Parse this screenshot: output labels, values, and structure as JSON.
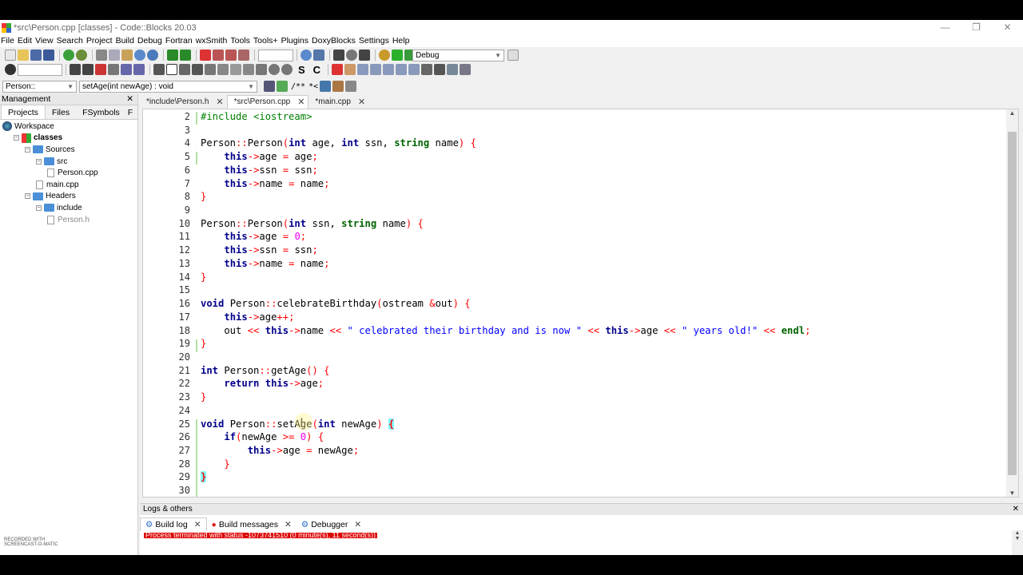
{
  "window": {
    "title": "*src\\Person.cpp [classes] - Code::Blocks 20.03",
    "controls": [
      "—",
      "❐",
      "✕"
    ]
  },
  "menu": [
    "File",
    "Edit",
    "View",
    "Search",
    "Project",
    "Build",
    "Debug",
    "Fortran",
    "wxSmith",
    "Tools",
    "Tools+",
    "Plugins",
    "DoxyBlocks",
    "Settings",
    "Help"
  ],
  "toolbar": {
    "build_target": "Debug",
    "scope_combo": "Person::",
    "function_combo": "setAge(int newAge) : void",
    "letter_s": "S",
    "letter_c": "C",
    "comment_btn": "/**",
    "doc_btn": "*<"
  },
  "management": {
    "title": "Management",
    "close": "✕",
    "tabs": [
      "Projects",
      "Files",
      "FSymbols",
      "F"
    ],
    "tree": [
      {
        "label": "Workspace",
        "level": 0,
        "kind": "workspace"
      },
      {
        "label": "classes",
        "level": 1,
        "kind": "project",
        "toggle": "−"
      },
      {
        "label": "Sources",
        "level": 2,
        "kind": "folder",
        "toggle": "−"
      },
      {
        "label": "src",
        "level": 3,
        "kind": "folder",
        "toggle": "−"
      },
      {
        "label": "Person.cpp",
        "level": 4,
        "kind": "file"
      },
      {
        "label": "main.cpp",
        "level": 3,
        "kind": "file"
      },
      {
        "label": "Headers",
        "level": 2,
        "kind": "folder",
        "toggle": "−"
      },
      {
        "label": "include",
        "level": 3,
        "kind": "folder",
        "toggle": "−"
      },
      {
        "label": "Person.h",
        "level": 4,
        "kind": "file"
      }
    ]
  },
  "editor": {
    "tabs": [
      {
        "label": "*include\\Person.h",
        "active": false
      },
      {
        "label": "*src\\Person.cpp",
        "active": true
      },
      {
        "label": "*main.cpp",
        "active": false
      }
    ],
    "tab_close": "✕",
    "lines": [
      {
        "n": "2",
        "code": "#include <iostream>"
      },
      {
        "n": "3",
        "code": ""
      },
      {
        "n": "4",
        "code": "Person::Person(int age, int ssn, string name) {"
      },
      {
        "n": "5",
        "code": "    this->age = age;"
      },
      {
        "n": "6",
        "code": "    this->ssn = ssn;"
      },
      {
        "n": "7",
        "code": "    this->name = name;"
      },
      {
        "n": "8",
        "code": "}"
      },
      {
        "n": "9",
        "code": ""
      },
      {
        "n": "10",
        "code": "Person::Person(int ssn, string name) {"
      },
      {
        "n": "11",
        "code": "    this->age = 0;"
      },
      {
        "n": "12",
        "code": "    this->ssn = ssn;"
      },
      {
        "n": "13",
        "code": "    this->name = name;"
      },
      {
        "n": "14",
        "code": "}"
      },
      {
        "n": "15",
        "code": ""
      },
      {
        "n": "16",
        "code": "void Person::celebrateBirthday(ostream &out) {"
      },
      {
        "n": "17",
        "code": "    this->age++;"
      },
      {
        "n": "18",
        "code": "    out << this->name << \" celebrated their birthday and is now \" << this->age << \" years old!\" << endl;"
      },
      {
        "n": "19",
        "code": "}"
      },
      {
        "n": "20",
        "code": ""
      },
      {
        "n": "21",
        "code": "int Person::getAge() {"
      },
      {
        "n": "22",
        "code": "    return this->age;"
      },
      {
        "n": "23",
        "code": "}"
      },
      {
        "n": "24",
        "code": ""
      },
      {
        "n": "25",
        "code": "void Person::setAge(int newAge) {"
      },
      {
        "n": "26",
        "code": "    if(newAge >= 0) {"
      },
      {
        "n": "27",
        "code": "        this->age = newAge;"
      },
      {
        "n": "28",
        "code": "    }"
      },
      {
        "n": "29",
        "code": "}"
      },
      {
        "n": "30",
        "code": ""
      }
    ]
  },
  "logs": {
    "title": "Logs & others",
    "close": "✕",
    "tabs": [
      "Build log",
      "Build messages",
      "Debugger"
    ],
    "log_line": "Process terminated with status -1073741510 (0 minute(s), 11 second(s))"
  },
  "watermark": "RECORDED WITH SCREENCAST-O-MATIC",
  "colors": {
    "keyword": "#00008b",
    "type_keyword": "#006400",
    "string": "#0000ff",
    "operator": "#ff0000",
    "preprocessor": "#008000",
    "number": "#f000f0",
    "brace_highlight": "#80ffff"
  }
}
